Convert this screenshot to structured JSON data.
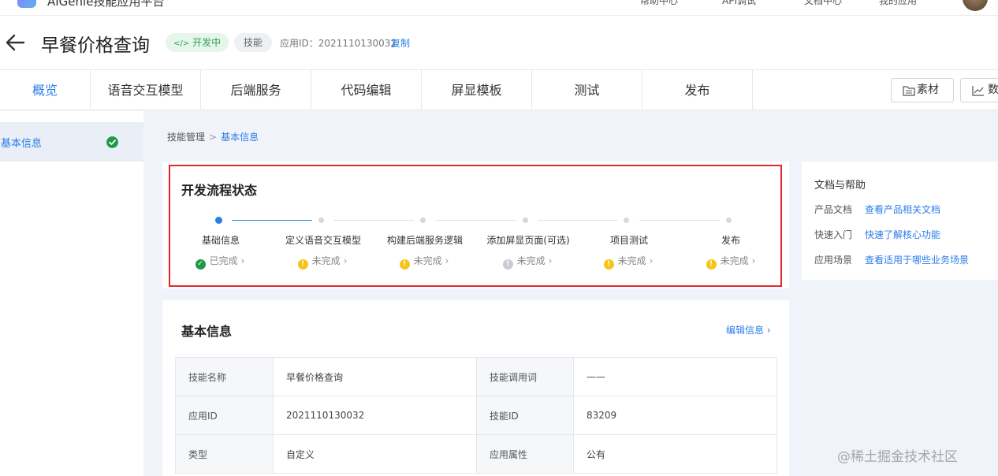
{
  "app": {
    "brand": "AIGenie技能应用平台"
  },
  "topbar_tools": [
    "帮助中心",
    "API调试",
    "文档中心",
    "我的应用"
  ],
  "header": {
    "title": "早餐价格查询",
    "status": "开发中",
    "type": "技能",
    "app_id_text": "应用ID：2021110130032",
    "copy": "复制"
  },
  "tabs": [
    "概览",
    "语音交互模型",
    "后端服务",
    "代码编辑",
    "屏显模板",
    "测试",
    "发布"
  ],
  "toolbar": {
    "material": "素材",
    "data": "数据"
  },
  "sidebar": {
    "items": [
      {
        "label": "基本信息"
      }
    ]
  },
  "breadcrumb": {
    "parent": "技能管理",
    "separator": ">",
    "current": "基本信息"
  },
  "process": {
    "title": "开发流程状态",
    "steps": [
      {
        "name": "基础信息",
        "status": "已完成"
      },
      {
        "name": "定义语音交互模型",
        "status": "未完成"
      },
      {
        "name": "构建后端服务逻辑",
        "status": "未完成"
      },
      {
        "name": "添加屏显页面(可选)",
        "status": "未完成"
      },
      {
        "name": "项目测试",
        "status": "未完成"
      },
      {
        "name": "发布",
        "status": "未完成"
      }
    ]
  },
  "help": {
    "title": "文档与帮助",
    "rows": [
      {
        "key": "产品文档",
        "link": "查看产品相关文档"
      },
      {
        "key": "快速入门",
        "link": "快速了解核心功能"
      },
      {
        "key": "应用场景",
        "link": "查看适用于哪些业务场景"
      }
    ]
  },
  "basic_info": {
    "title": "基本信息",
    "edit": "编辑信息",
    "rows": [
      [
        "技能名称",
        "早餐价格查询",
        "技能调用词",
        "——"
      ],
      [
        "应用ID",
        "2021110130032",
        "技能ID",
        "83209"
      ],
      [
        "类型",
        "自定义",
        "应用属性",
        "公有"
      ]
    ]
  },
  "watermark": "@稀土掘金技术社区",
  "colors": {
    "accent": "#2b7de9",
    "success": "#1f9a47",
    "pending": "#f5c518",
    "highlight": "#e02a2a"
  }
}
